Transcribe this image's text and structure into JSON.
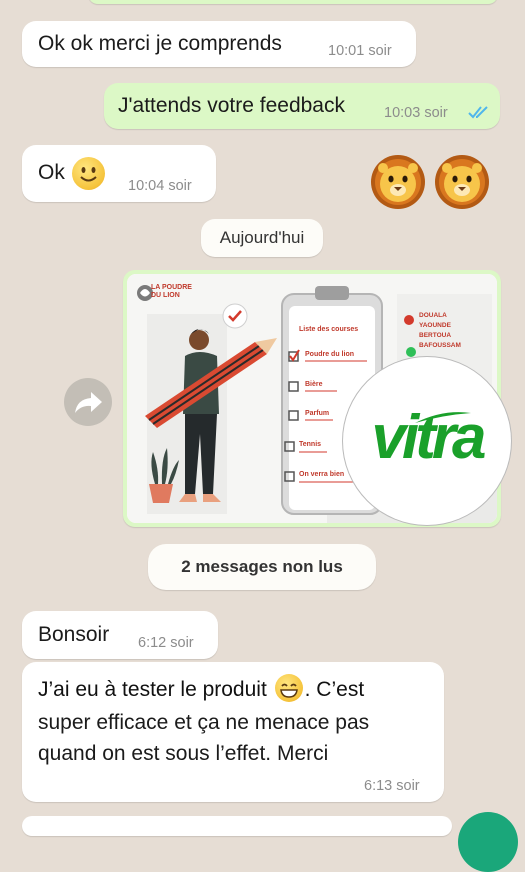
{
  "chat": {
    "m1": {
      "text": "Ok ok merci je comprends",
      "time": "10:01 soir"
    },
    "m2": {
      "text": "J'attends votre feedback",
      "time": "10:03 soir",
      "status": "read-double-check"
    },
    "m3": {
      "text": "Ok",
      "time": "10:04 soir",
      "emoji": "slightly-smiling-face"
    },
    "m4": {
      "emoji": "lion-face-x2"
    },
    "date_divider": "Aujourd'hui",
    "image_msg": {
      "brand_logo": "LA POUDRE DU LION",
      "list_title": "Liste des courses",
      "list_items": [
        "Poudre du lion",
        "Bière",
        "Parfum",
        "Tennis",
        "On verra bien"
      ],
      "cities": [
        "DOUALA",
        "YAOUNDE",
        "BERTOUA",
        "BAFOUSSAM"
      ]
    },
    "unread_banner": "2 messages non lus",
    "m5": {
      "text": "Bonsoir",
      "time": "6:12 soir"
    },
    "m6": {
      "line1a": "J’ai eu à tester le produit",
      "line1b": ". C’est",
      "line2": "super efficace et ça ne menace pas",
      "line3": "quand on est sous l’effet. Merci",
      "time": "6:13 soir"
    }
  },
  "watermark": "vitra",
  "colors": {
    "background": "#e6ddd4",
    "outgoing": "#dcf8c6",
    "incoming": "#ffffff",
    "read_ticks": "#4fb6ec",
    "watermark_green": "#1aa02a"
  }
}
